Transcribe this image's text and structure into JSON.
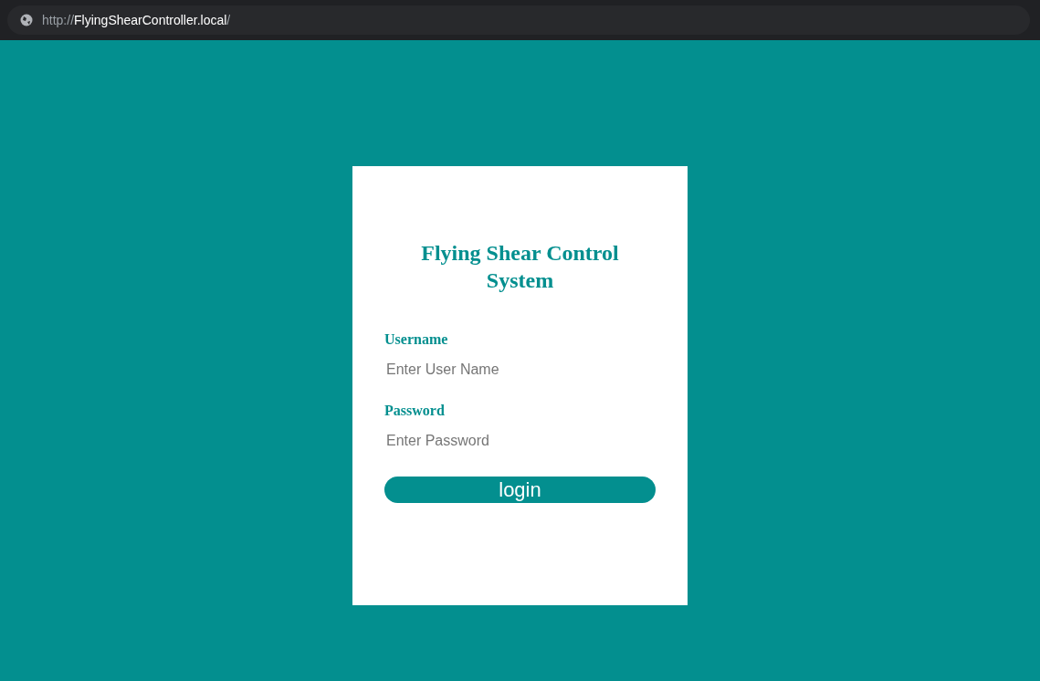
{
  "address_bar": {
    "scheme": "http://",
    "host": "FlyingShearController.local",
    "path": "/"
  },
  "login_card": {
    "title": "Flying Shear Control System",
    "fields": [
      {
        "label": "Username",
        "placeholder": "Enter User Name"
      },
      {
        "label": "Password",
        "placeholder": "Enter Password"
      }
    ],
    "button": "login"
  }
}
